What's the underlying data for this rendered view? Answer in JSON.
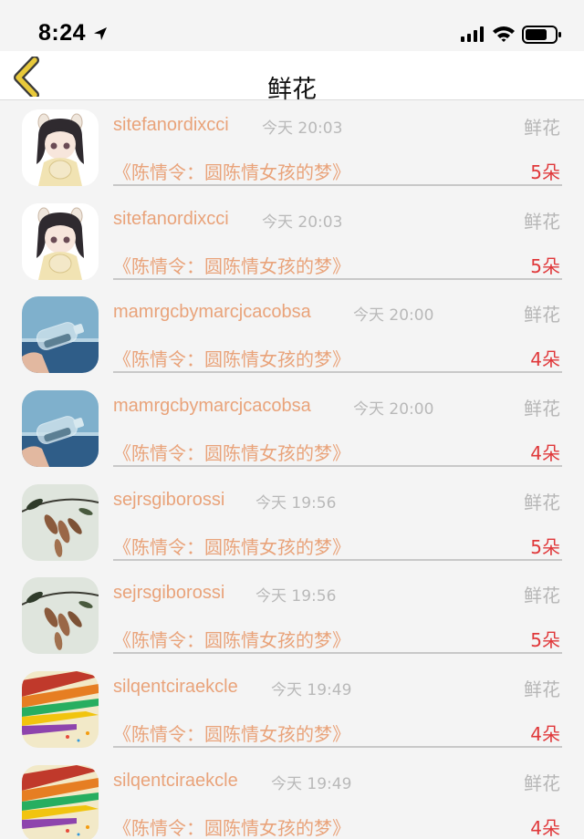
{
  "status_bar": {
    "time": "8:24"
  },
  "nav": {
    "title": "鲜花"
  },
  "colors": {
    "accent": "#e9a37a",
    "count_red": "#e0383a",
    "back_icon": "#e8c93a",
    "muted": "#b9b9b9"
  },
  "rows": [
    {
      "username": "sitefanordixcci",
      "time": "今天 20:03",
      "type": "鲜花",
      "work_title": "《陈情令：圆陈情女孩的梦》",
      "count": "5朵",
      "avatar": "anime-girl"
    },
    {
      "username": "sitefanordixcci",
      "time": "今天 20:03",
      "type": "鲜花",
      "work_title": "《陈情令：圆陈情女孩的梦》",
      "count": "5朵",
      "avatar": "anime-girl"
    },
    {
      "username": "mamrgcbymarcjcacobsa",
      "time": "今天 20:00",
      "type": "鲜花",
      "work_title": "《陈情令：圆陈情女孩的梦》",
      "count": "4朵",
      "avatar": "bottle-sea"
    },
    {
      "username": "mamrgcbymarcjcacobsa",
      "time": "今天 20:00",
      "type": "鲜花",
      "work_title": "《陈情令：圆陈情女孩的梦》",
      "count": "4朵",
      "avatar": "bottle-sea"
    },
    {
      "username": "sejrsgiborossi",
      "time": "今天 19:56",
      "type": "鲜花",
      "work_title": "《陈情令：圆陈情女孩的梦》",
      "count": "5朵",
      "avatar": "leaves"
    },
    {
      "username": "sejrsgiborossi",
      "time": "今天 19:56",
      "type": "鲜花",
      "work_title": "《陈情令：圆陈情女孩的梦》",
      "count": "5朵",
      "avatar": "leaves"
    },
    {
      "username": "silqentciraekcle",
      "time": "今天 19:49",
      "type": "鲜花",
      "work_title": "《陈情令：圆陈情女孩的梦》",
      "count": "4朵",
      "avatar": "pencils"
    },
    {
      "username": "silqentciraekcle",
      "time": "今天 19:49",
      "type": "鲜花",
      "work_title": "《陈情令：圆陈情女孩的梦》",
      "count": "4朵",
      "avatar": "pencils"
    }
  ]
}
